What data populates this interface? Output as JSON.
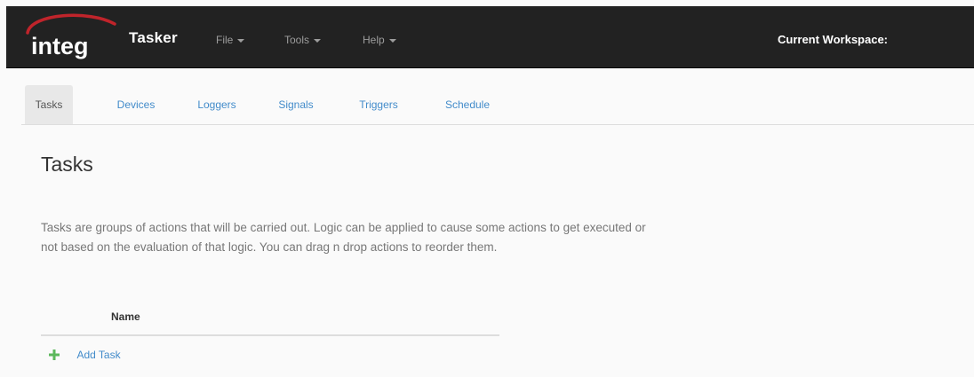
{
  "navbar": {
    "logo_text": "integ",
    "brand": "Tasker",
    "menus": [
      {
        "label": "File"
      },
      {
        "label": "Tools"
      },
      {
        "label": "Help"
      }
    ],
    "workspace_label": "Current Workspace:"
  },
  "tabs": [
    {
      "label": "Tasks",
      "active": true
    },
    {
      "label": "Devices",
      "active": false
    },
    {
      "label": "Loggers",
      "active": false
    },
    {
      "label": "Signals",
      "active": false
    },
    {
      "label": "Triggers",
      "active": false
    },
    {
      "label": "Schedule",
      "active": false
    }
  ],
  "main": {
    "title": "Tasks",
    "description_line1": "Tasks are groups of actions that will be carried out. Logic can be applied to cause some actions to get executed or",
    "description_line2": "not based on the evaluation of that logic. You can drag n drop actions to reorder them.",
    "table": {
      "columns": [
        "Name"
      ]
    },
    "add_task_label": "Add Task"
  },
  "colors": {
    "navbar_bg": "#222222",
    "logo_swoosh": "#c0242b",
    "link": "#428bca",
    "plus_icon": "#5cb85c"
  },
  "icons": {
    "add": "plus-icon",
    "menu_caret": "caret-down-icon"
  }
}
